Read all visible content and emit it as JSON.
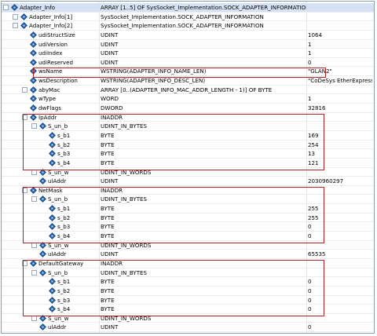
{
  "colors": {
    "highlight": "#b22222",
    "selected_row": "#d6e2f3",
    "grid_line": "#e2e2e2"
  },
  "rows": [
    {
      "name": "Adapter_Info",
      "type": "ARRAY [1..5] OF SysSocket_Implementation.SOCK_ADAPTER_INFORMATION",
      "value": "",
      "level": 0,
      "toggle": "−",
      "icon": "variable-icon",
      "sel": true
    },
    {
      "name": "Adapter_Info[1]",
      "type": "SysSocket_Implementation.SOCK_ADAPTER_INFORMATION",
      "value": "",
      "level": 1,
      "toggle": "+",
      "icon": "variable-icon"
    },
    {
      "name": "Adapter_Info[2]",
      "type": "SysSocket_Implementation.SOCK_ADAPTER_INFORMATION",
      "value": "",
      "level": 1,
      "toggle": "−",
      "icon": "variable-icon"
    },
    {
      "name": "udiStructSize",
      "type": "UDINT",
      "value": "1064",
      "level": 2,
      "toggle": "",
      "icon": "variable-icon"
    },
    {
      "name": "udiVersion",
      "type": "UDINT",
      "value": "1",
      "level": 2,
      "toggle": "",
      "icon": "variable-icon"
    },
    {
      "name": "udiIndex",
      "type": "UDINT",
      "value": "1",
      "level": 2,
      "toggle": "",
      "icon": "variable-icon"
    },
    {
      "name": "udiReserved",
      "type": "UDINT",
      "value": "0",
      "level": 2,
      "toggle": "",
      "icon": "variable-icon"
    },
    {
      "name": "wsName",
      "type": "WSTRING(ADAPTER_INFO_NAME_LEN)",
      "value": "\"GLAN2\"",
      "level": 2,
      "toggle": "",
      "icon": "variable-icon"
    },
    {
      "name": "wsDescription",
      "type": "WSTRING(ADAPTER_INFO_DESC_LEN)",
      "value": "\"CoDeSys EtherExpress...",
      "level": 2,
      "toggle": "",
      "icon": "variable-icon"
    },
    {
      "name": "abyMac",
      "type": "ARRAY [0..(ADAPTER_INFO_MAC_ADDR_LENGTH - 1)] OF BYTE",
      "value": "",
      "level": 2,
      "toggle": "+",
      "icon": "variable-icon"
    },
    {
      "name": "wType",
      "type": "WORD",
      "value": "1",
      "level": 2,
      "toggle": "",
      "icon": "variable-icon"
    },
    {
      "name": "dwFlags",
      "type": "DWORD",
      "value": "32816",
      "level": 2,
      "toggle": "",
      "icon": "variable-icon"
    },
    {
      "name": "IpAddr",
      "type": "INADDR",
      "value": "",
      "level": 2,
      "toggle": "−",
      "icon": "variable-icon"
    },
    {
      "name": "S_un_b",
      "type": "UDINT_IN_BYTES",
      "value": "",
      "level": 3,
      "toggle": "−",
      "icon": "variable-icon"
    },
    {
      "name": "s_b1",
      "type": "BYTE",
      "value": "169",
      "level": 4,
      "toggle": "",
      "icon": "variable-icon"
    },
    {
      "name": "s_b2",
      "type": "BYTE",
      "value": "254",
      "level": 4,
      "toggle": "",
      "icon": "variable-icon"
    },
    {
      "name": "s_b3",
      "type": "BYTE",
      "value": "13",
      "level": 4,
      "toggle": "",
      "icon": "variable-icon"
    },
    {
      "name": "s_b4",
      "type": "BYTE",
      "value": "121",
      "level": 4,
      "toggle": "",
      "icon": "variable-icon"
    },
    {
      "name": "S_un_w",
      "type": "UDINT_IN_WORDS",
      "value": "",
      "level": 3,
      "toggle": "+",
      "icon": "variable-icon"
    },
    {
      "name": "ulAddr",
      "type": "UDINT",
      "value": "2030960297",
      "level": 3,
      "toggle": "",
      "icon": "variable-icon"
    },
    {
      "name": "NetMask",
      "type": "INADDR",
      "value": "",
      "level": 2,
      "toggle": "−",
      "icon": "variable-icon"
    },
    {
      "name": "S_un_b",
      "type": "UDINT_IN_BYTES",
      "value": "",
      "level": 3,
      "toggle": "−",
      "icon": "variable-icon"
    },
    {
      "name": "s_b1",
      "type": "BYTE",
      "value": "255",
      "level": 4,
      "toggle": "",
      "icon": "variable-icon"
    },
    {
      "name": "s_b2",
      "type": "BYTE",
      "value": "255",
      "level": 4,
      "toggle": "",
      "icon": "variable-icon"
    },
    {
      "name": "s_b3",
      "type": "BYTE",
      "value": "0",
      "level": 4,
      "toggle": "",
      "icon": "variable-icon"
    },
    {
      "name": "s_b4",
      "type": "BYTE",
      "value": "0",
      "level": 4,
      "toggle": "",
      "icon": "variable-icon"
    },
    {
      "name": "S_un_w",
      "type": "UDINT_IN_WORDS",
      "value": "",
      "level": 3,
      "toggle": "+",
      "icon": "variable-icon"
    },
    {
      "name": "ulAddr",
      "type": "UDINT",
      "value": "65535",
      "level": 3,
      "toggle": "",
      "icon": "variable-icon"
    },
    {
      "name": "DefaultGateway",
      "type": "INADDR",
      "value": "",
      "level": 2,
      "toggle": "−",
      "icon": "variable-icon"
    },
    {
      "name": "S_un_b",
      "type": "UDINT_IN_BYTES",
      "value": "",
      "level": 3,
      "toggle": "−",
      "icon": "variable-icon"
    },
    {
      "name": "s_b1",
      "type": "BYTE",
      "value": "0",
      "level": 4,
      "toggle": "",
      "icon": "variable-icon"
    },
    {
      "name": "s_b2",
      "type": "BYTE",
      "value": "0",
      "level": 4,
      "toggle": "",
      "icon": "variable-icon"
    },
    {
      "name": "s_b3",
      "type": "BYTE",
      "value": "0",
      "level": 4,
      "toggle": "",
      "icon": "variable-icon"
    },
    {
      "name": "s_b4",
      "type": "BYTE",
      "value": "0",
      "level": 4,
      "toggle": "",
      "icon": "variable-icon"
    },
    {
      "name": "S_un_w",
      "type": "UDINT_IN_WORDS",
      "value": "",
      "level": 3,
      "toggle": "+",
      "icon": "variable-icon"
    },
    {
      "name": "ulAddr",
      "type": "UDINT",
      "value": "0",
      "level": 3,
      "toggle": "",
      "icon": "variable-icon"
    }
  ]
}
